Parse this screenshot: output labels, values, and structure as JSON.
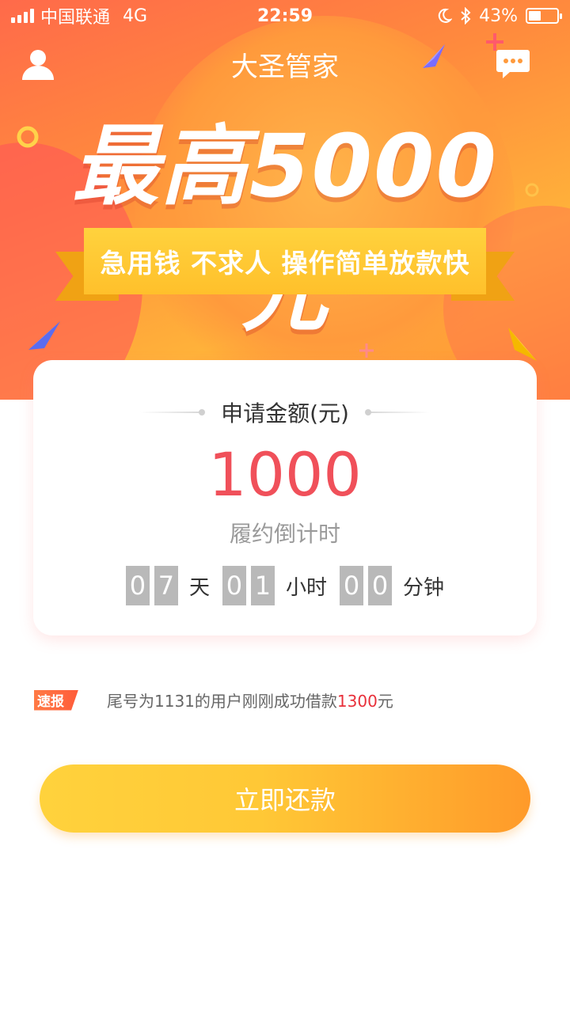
{
  "status_bar": {
    "carrier": "中国联通",
    "network": "4G",
    "time": "22:59",
    "battery": "43%",
    "battery_level": 0.43
  },
  "nav": {
    "title": "大圣管家",
    "left_icon": "user-icon",
    "right_icon": "message-icon"
  },
  "banner": {
    "headline": "最高5000元",
    "slogan": "急用钱 不求人 操作简单放款快"
  },
  "card": {
    "title": "申请金额(元)",
    "amount": "1000",
    "countdown_label": "履约倒计时",
    "countdown": {
      "days": [
        "0",
        "7"
      ],
      "days_unit": "天",
      "hours": [
        "0",
        "1"
      ],
      "hours_unit": "小时",
      "minutes": [
        "0",
        "0"
      ],
      "minutes_unit": "分钟"
    }
  },
  "news": {
    "badge": "速报",
    "text_prefix": "尾号为1131的用户刚刚成功借款",
    "amount": "1300",
    "unit": "元"
  },
  "cta": {
    "label": "立即还款"
  },
  "colors": {
    "accent_red": "#f0505a",
    "button_start": "#ffd23c",
    "button_end": "#ff9a2a"
  }
}
